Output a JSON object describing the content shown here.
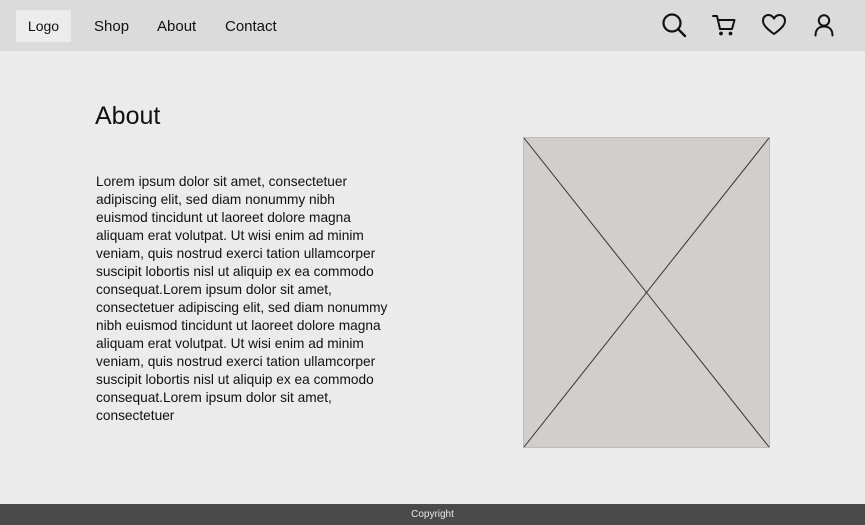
{
  "header": {
    "logo_label": "Logo",
    "nav": [
      {
        "label": "Shop"
      },
      {
        "label": "About"
      },
      {
        "label": "Contact"
      }
    ],
    "icons": [
      "search-icon",
      "cart-icon",
      "heart-icon",
      "user-icon"
    ]
  },
  "main": {
    "title": "About",
    "body_text": "Lorem ipsum dolor sit amet, consectetuer adipiscing elit, sed diam nonummy nibh euismod tincidunt ut laoreet dolore magna aliquam erat volutpat. Ut wisi enim ad minim veniam, quis nostrud exerci tation ullamcorper suscipit lobortis nisl ut aliquip ex ea commodo consequat.Lorem ipsum dolor sit amet, consectetuer adipiscing elit, sed diam nonummy nibh euismod tincidunt ut laoreet dolore magna aliquam erat volutpat. Ut wisi enim ad minim veniam, quis nostrud exerci tation ullamcorper suscipit lobortis nisl ut aliquip ex ea commodo consequat.Lorem ipsum dolor sit amet, consectetuer"
  },
  "footer": {
    "text": "Copyright"
  },
  "colors": {
    "navbar_bg": "#dcdbdc",
    "page_bg": "#ebebeb",
    "logo_bg": "#ececec",
    "image_placeholder_bg": "#d0cfcd",
    "footer_bg": "#4a4a4a",
    "footer_text": "#e8e8e8",
    "text": "#111111"
  }
}
